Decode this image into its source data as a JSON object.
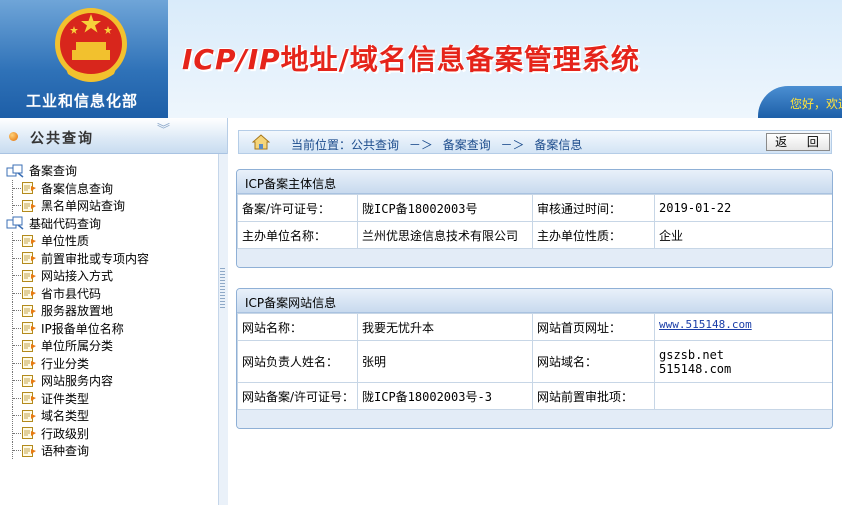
{
  "header": {
    "org_name": "工业和信息化部",
    "title_latin": "ICP/IP",
    "title_rest": "地址/域名信息备案管理系统",
    "welcome": "您好，欢迎"
  },
  "sidebar": {
    "title": "公共查询",
    "chevron": "︾",
    "groups": [
      {
        "label": "备案查询",
        "items": [
          "备案信息查询",
          "黑名单网站查询"
        ]
      },
      {
        "label": "基础代码查询",
        "items": [
          "单位性质",
          "前置审批或专项内容",
          "网站接入方式",
          "省市县代码",
          "服务器放置地",
          "IP报备单位名称",
          "单位所属分类",
          "行业分类",
          "网站服务内容",
          "证件类型",
          "域名类型",
          "行政级别",
          "语种查询"
        ]
      }
    ]
  },
  "breadcrumb": {
    "prefix": "当前位置：",
    "items": [
      "公共查询",
      "－＞",
      "备案查询",
      "－＞",
      "备案信息"
    ],
    "back": "返 回"
  },
  "subject_panel": {
    "title": "ICP备案主体信息",
    "rows": [
      [
        "备案/许可证号：",
        "陇ICP备18002003号",
        "审核通过时间：",
        "2019-01-22"
      ],
      [
        "主办单位名称：",
        "兰州优思途信息技术有限公司",
        "主办单位性质：",
        "企业"
      ]
    ]
  },
  "site_panel": {
    "title": "ICP备案网站信息",
    "site_name_label": "网站名称：",
    "site_name": "我要无忧升本",
    "homepage_label": "网站首页网址：",
    "homepage": "www.515148.com",
    "owner_label": "网站负责人姓名：",
    "owner": "张明",
    "domain_label": "网站域名：",
    "domains": [
      "gszsb.net",
      "515148.com"
    ],
    "record_label": "网站备案/许可证号：",
    "record": "陇ICP备18002003号-3",
    "preapproval_label": "网站前置审批项：",
    "preapproval": ""
  },
  "colors": {
    "title_red": "#e5241a",
    "header_blue": "#2f72b8",
    "panel_border": "#8fb0d6"
  }
}
